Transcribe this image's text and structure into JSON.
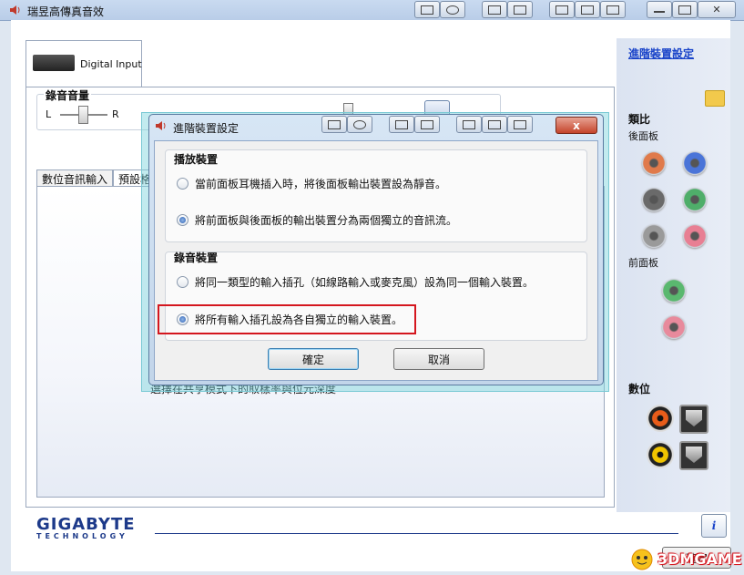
{
  "window": {
    "title": "瑞昱高傳真音效"
  },
  "device_tab": {
    "label": "Digital Input"
  },
  "volume": {
    "title": "錄音音量",
    "left": "L",
    "right": "R"
  },
  "subtabs": [
    "數位音訊輸入",
    "預設格"
  ],
  "subpanel_text": "選擇在共享模式下的取樣率與位元深度",
  "right_panel": {
    "advanced_link": "進階裝置設定",
    "analog_title": "類比",
    "rear_panel": "後面板",
    "front_panel": "前面板",
    "digital_title": "數位"
  },
  "jacks": {
    "rear": [
      "#e07a4b",
      "#4a74d8",
      "#6a6a6a",
      "#4fae6a",
      "#9a9a9a",
      "#e87f93"
    ],
    "front": [
      "#5ab86f",
      "#e88a9c"
    ],
    "digital": [
      "#e85c1a",
      "#f0c400"
    ]
  },
  "footer": {
    "brand": "GIGABYTE",
    "brand_sub": "TECHNOLOGY",
    "info_icon": "i",
    "ok_label": "確定"
  },
  "dialog": {
    "title": "進階裝置設定",
    "close": "x",
    "playback": {
      "title": "播放裝置",
      "options": [
        {
          "label": "當前面板耳機插入時，將後面板輸出裝置設為靜音。",
          "selected": false
        },
        {
          "label": "將前面板與後面板的輸出裝置分為兩個獨立的音訊流。",
          "selected": true
        }
      ]
    },
    "recording": {
      "title": "錄音裝置",
      "options": [
        {
          "label": "將同一類型的輸入插孔（如線路輸入或麥克風）設為同一個輸入裝置。",
          "selected": false
        },
        {
          "label": "將所有輸入插孔設為各自獨立的輸入裝置。",
          "selected": true
        }
      ]
    },
    "ok_label": "確定",
    "cancel_label": "取消"
  },
  "watermark": "3DMGAME"
}
